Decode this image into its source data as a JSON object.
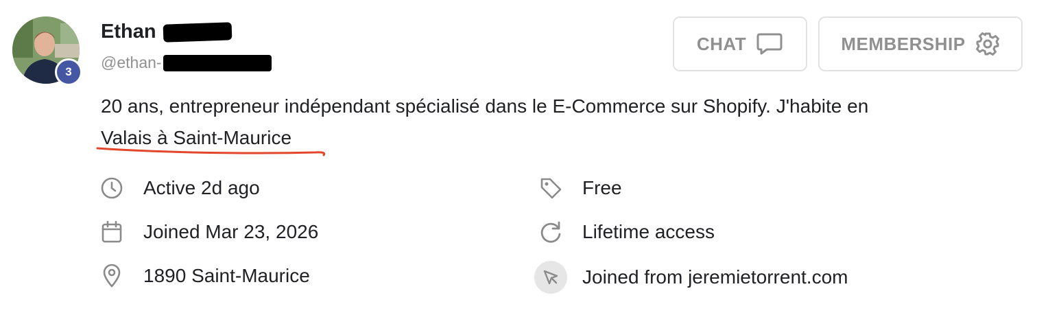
{
  "profile": {
    "first_name": "Ethan",
    "handle": "@ethan-",
    "level": "3",
    "bio_line1": "20 ans, entrepreneur indépendant spécialisé dans le E-Commerce sur Shopify. J'habite en",
    "bio_line2": "Valais à Saint-Maurice"
  },
  "actions": {
    "chat_label": "CHAT",
    "membership_label": "MEMBERSHIP"
  },
  "details_left": {
    "active": "Active 2d ago",
    "joined": "Joined Mar 23, 2026",
    "location": "1890 Saint-Maurice"
  },
  "details_right": {
    "price": "Free",
    "access": "Lifetime access",
    "source": "Joined from jeremietorrent.com"
  },
  "colors": {
    "badge": "#4557a3",
    "underline": "#e2462b",
    "muted": "#909090",
    "border": "#e2e2e2"
  },
  "icons": [
    "clock-icon",
    "calendar-icon",
    "location-pin-icon",
    "tag-icon",
    "refresh-icon",
    "cursor-icon",
    "chat-bubble-icon",
    "gear-icon"
  ]
}
